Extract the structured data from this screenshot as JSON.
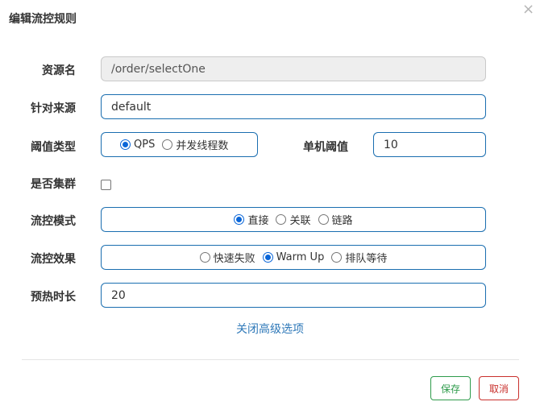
{
  "dialog": {
    "title": "编辑流控规则",
    "close_glyph": "×"
  },
  "form": {
    "resource": {
      "label": "资源名",
      "value": "/order/selectOne"
    },
    "limit_app": {
      "label": "针对来源",
      "value": "default"
    },
    "threshold_type": {
      "label": "阈值类型",
      "options": [
        {
          "label": "QPS",
          "checked": true
        },
        {
          "label": "并发线程数",
          "checked": false
        }
      ]
    },
    "single_threshold": {
      "label": "单机阈值",
      "value": "10"
    },
    "cluster_mode": {
      "label": "是否集群",
      "checked": false
    },
    "strategy": {
      "label": "流控模式",
      "options": [
        {
          "label": "直接",
          "checked": true
        },
        {
          "label": "关联",
          "checked": false
        },
        {
          "label": "链路",
          "checked": false
        }
      ]
    },
    "control_behavior": {
      "label": "流控效果",
      "options": [
        {
          "label": "快速失败",
          "checked": false
        },
        {
          "label": "Warm Up",
          "checked": true
        },
        {
          "label": "排队等待",
          "checked": false
        }
      ]
    },
    "warmup_period": {
      "label": "预热时长",
      "value": "20"
    },
    "advanced_link": "关闭高级选项"
  },
  "footer": {
    "save_label": "保存",
    "cancel_label": "取消"
  },
  "colors": {
    "accent_blue": "#1a6eb0",
    "radio_checked": "#0a66d8",
    "save_green": "#2e9b4b",
    "cancel_red": "#c9302c",
    "link_blue": "#2f79b9"
  }
}
